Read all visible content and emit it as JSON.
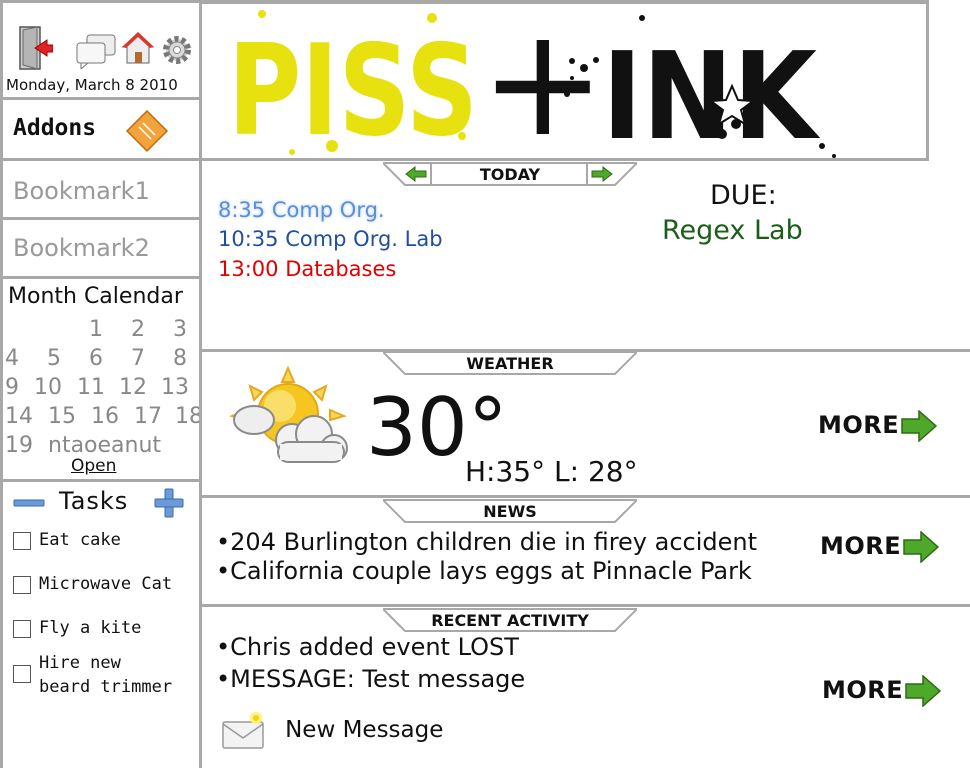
{
  "header": {
    "date": "Monday, March 8 2010",
    "addons_label": "Addons",
    "logo_left": "PISS",
    "logo_plus": "+",
    "logo_right": "INK",
    "icons": [
      "logout-icon",
      "chat-icon",
      "home-icon",
      "gear-icon",
      "addons-diamond-icon"
    ]
  },
  "sidebar": {
    "bookmarks": [
      "Bookmark1",
      "Bookmark2"
    ],
    "calendar": {
      "title": "Month Calendar",
      "rows": [
        [
          "",
          "",
          "",
          "1",
          "2",
          "3"
        ],
        [
          "4",
          "5",
          "6",
          "7",
          "8"
        ],
        [
          "9",
          "10",
          "11",
          "12",
          "13"
        ],
        [
          "14",
          "15",
          "16",
          "17",
          "18"
        ],
        [
          "19",
          "ntaoeanut"
        ]
      ],
      "open_label": "Open"
    },
    "tasks": {
      "title": "Tasks",
      "items": [
        "Eat cake",
        "Microwave Cat",
        "Fly a kite",
        "Hire new",
        "beard trimmer"
      ]
    }
  },
  "today": {
    "tab_label": "TODAY",
    "events": [
      {
        "text": "8:35 Comp Org.",
        "color": "#5b8fd6"
      },
      {
        "text": "10:35 Comp Org. Lab",
        "color": "#1f4fa0"
      },
      {
        "text": "13:00 Databases",
        "color": "#e00000"
      }
    ],
    "due_label": "DUE:",
    "due_item": "Regex Lab",
    "due_color": "#1b5e1b"
  },
  "weather": {
    "tab_label": "WEATHER",
    "temp": "30°",
    "hilo": "H:35° L: 28°",
    "more": "MORE"
  },
  "news": {
    "tab_label": "NEWS",
    "items": [
      "•204 Burlington children die in firey accident",
      "•California couple lays eggs at Pinnacle Park"
    ],
    "more": "MORE"
  },
  "activity": {
    "tab_label": "RECENT ACTIVITY",
    "items": [
      "•Chris added event LOST",
      "•MESSAGE: Test message"
    ],
    "new_message": "New Message",
    "more": "MORE"
  }
}
